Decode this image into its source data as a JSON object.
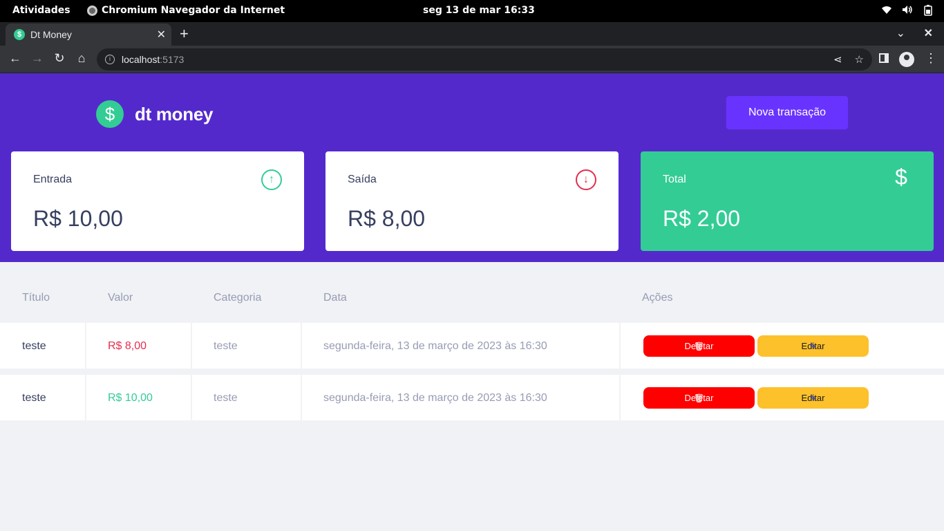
{
  "system_bar": {
    "activities": "Atividades",
    "app_name": "Chromium Navegador da Internet",
    "clock": "seg 13 de mar  16:33"
  },
  "browser": {
    "tab_title": "Dt Money",
    "url_host": "localhost",
    "url_port": ":5173"
  },
  "header": {
    "logo_symbol": "$",
    "logo_text": "dt money",
    "new_transaction_label": "Nova transação"
  },
  "summary": {
    "income": {
      "label": "Entrada",
      "value": "R$ 10,00",
      "icon": "arrow-up-circle-icon"
    },
    "outcome": {
      "label": "Saída",
      "value": "R$ 8,00",
      "icon": "arrow-down-circle-icon"
    },
    "total": {
      "label": "Total",
      "value": "R$ 2,00",
      "icon": "dollar-sign-icon"
    }
  },
  "table": {
    "columns": [
      "Título",
      "Valor",
      "Categoria",
      "Data",
      "Ações"
    ],
    "rows": [
      {
        "title": "teste",
        "amount": "R$ 8,00",
        "type": "withdraw",
        "category": "teste",
        "date": "segunda-feira, 13 de março de 2023 às 16:30"
      },
      {
        "title": "teste",
        "amount": "R$ 10,00",
        "type": "deposit",
        "category": "teste",
        "date": "segunda-feira, 13 de março de 2023 às 16:30"
      }
    ],
    "delete_label": "Deletar",
    "edit_label": "Editar"
  },
  "colors": {
    "header_bg": "#5429cc",
    "green": "#33cc95",
    "red": "#e52e4d",
    "button_purple": "#6933ff",
    "delete_red": "#ff0000",
    "edit_yellow": "#fcc12b"
  }
}
